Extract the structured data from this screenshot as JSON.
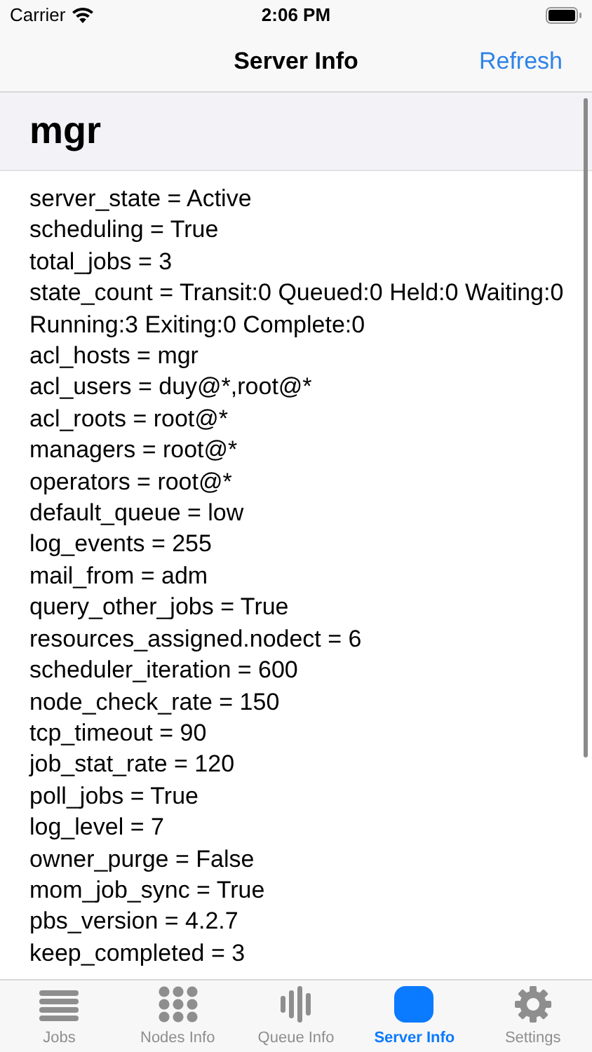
{
  "status_bar": {
    "carrier": "Carrier",
    "time": "2:06 PM"
  },
  "nav_bar": {
    "title": "Server Info",
    "action": "Refresh"
  },
  "section": {
    "title": "mgr"
  },
  "lines": [
    "server_state = Active",
    "scheduling = True",
    "total_jobs = 3",
    "state_count = Transit:0 Queued:0 Held:0 Waiting:0 Running:3 Exiting:0 Complete:0",
    "acl_hosts = mgr",
    "acl_users = duy@*,root@*",
    "acl_roots = root@*",
    "managers = root@*",
    "operators = root@*",
    "default_queue = low",
    "log_events = 255",
    "mail_from = adm",
    "query_other_jobs = True",
    "resources_assigned.nodect = 6",
    "scheduler_iteration = 600",
    "node_check_rate = 150",
    "tcp_timeout = 90",
    "job_stat_rate = 120",
    "poll_jobs = True",
    "log_level = 7",
    "owner_purge = False",
    "mom_job_sync = True",
    "pbs_version = 4.2.7",
    "keep_completed = 3"
  ],
  "tabs": [
    {
      "label": "Jobs",
      "kind": "list",
      "selected": false
    },
    {
      "label": "Nodes Info",
      "kind": "grid",
      "selected": false
    },
    {
      "label": "Queue Info",
      "kind": "bars",
      "selected": false
    },
    {
      "label": "Server Info",
      "kind": "square",
      "selected": true
    },
    {
      "label": "Settings",
      "kind": "gear",
      "selected": false
    }
  ]
}
